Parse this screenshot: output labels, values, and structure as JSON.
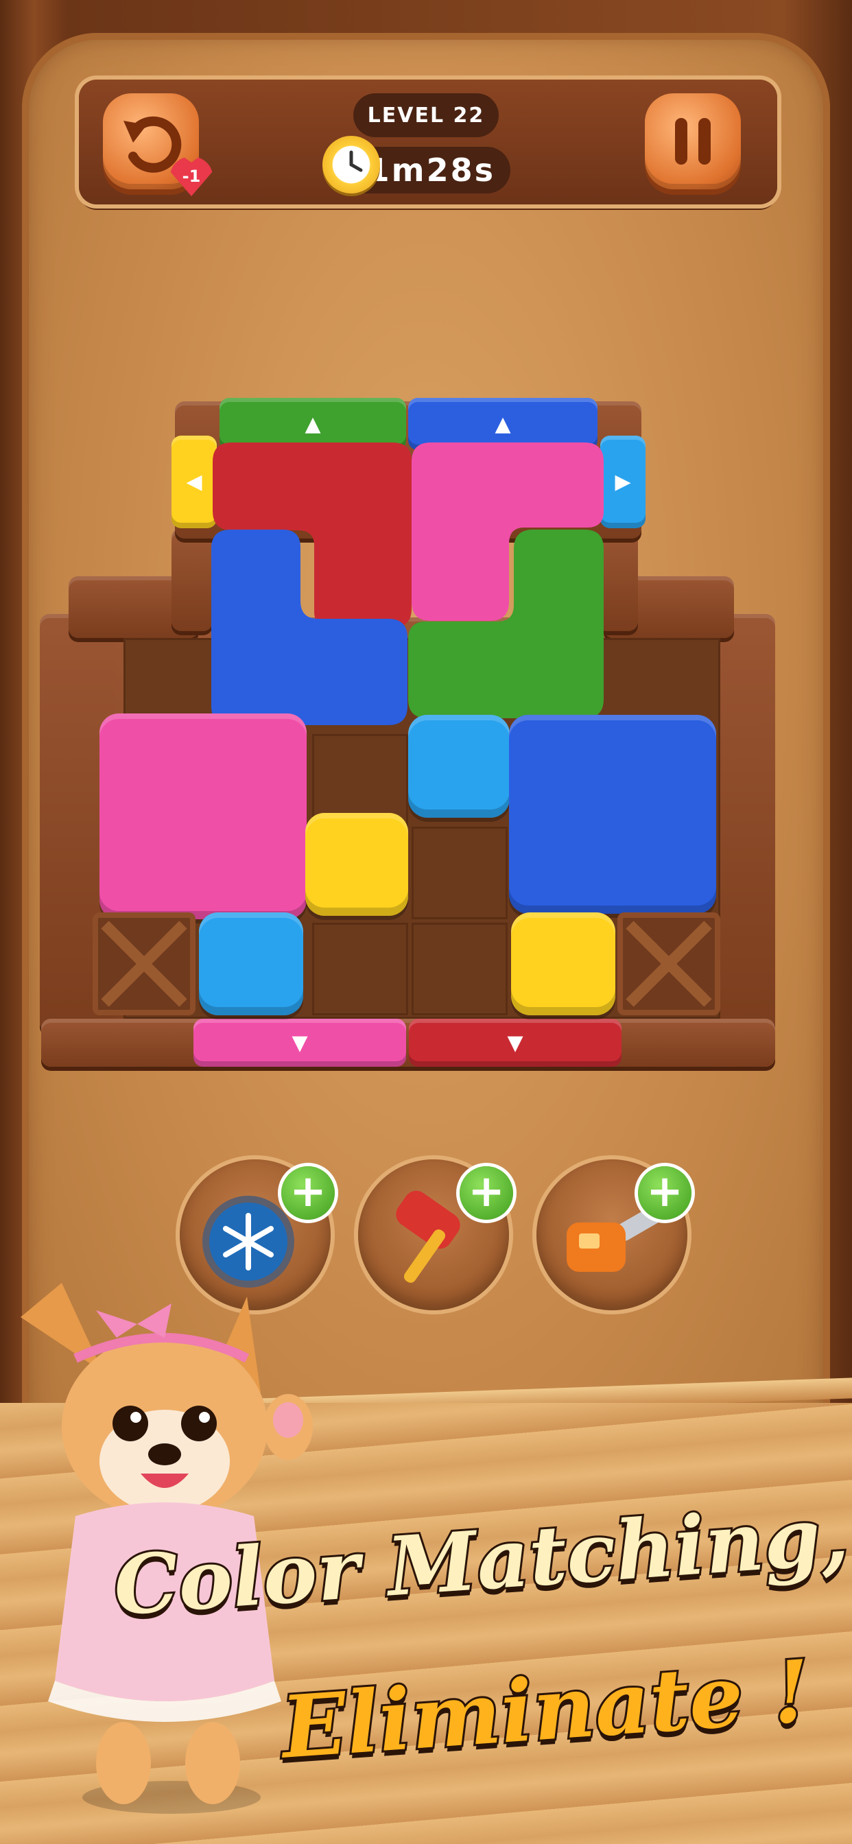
{
  "header": {
    "level_label": "LEVEL 22",
    "timer": "1m28s",
    "undo_cost": "-1"
  },
  "colors": {
    "green": "#3fa12e",
    "blue": "#2b5fe0",
    "yellow": "#ffd21f",
    "red": "#c92a32",
    "pink": "#f04fa8",
    "cyan": "#2aa3ee",
    "wood": "#7a3d1d"
  },
  "boosters": [
    {
      "name": "freeze-timer",
      "icon": "snowflake-stopwatch-icon"
    },
    {
      "name": "hammer",
      "icon": "hammer-icon"
    },
    {
      "name": "chainsaw",
      "icon": "chainsaw-icon"
    }
  ],
  "tagline": {
    "line1": "Color Matching,",
    "line2": "Eliminate !"
  }
}
